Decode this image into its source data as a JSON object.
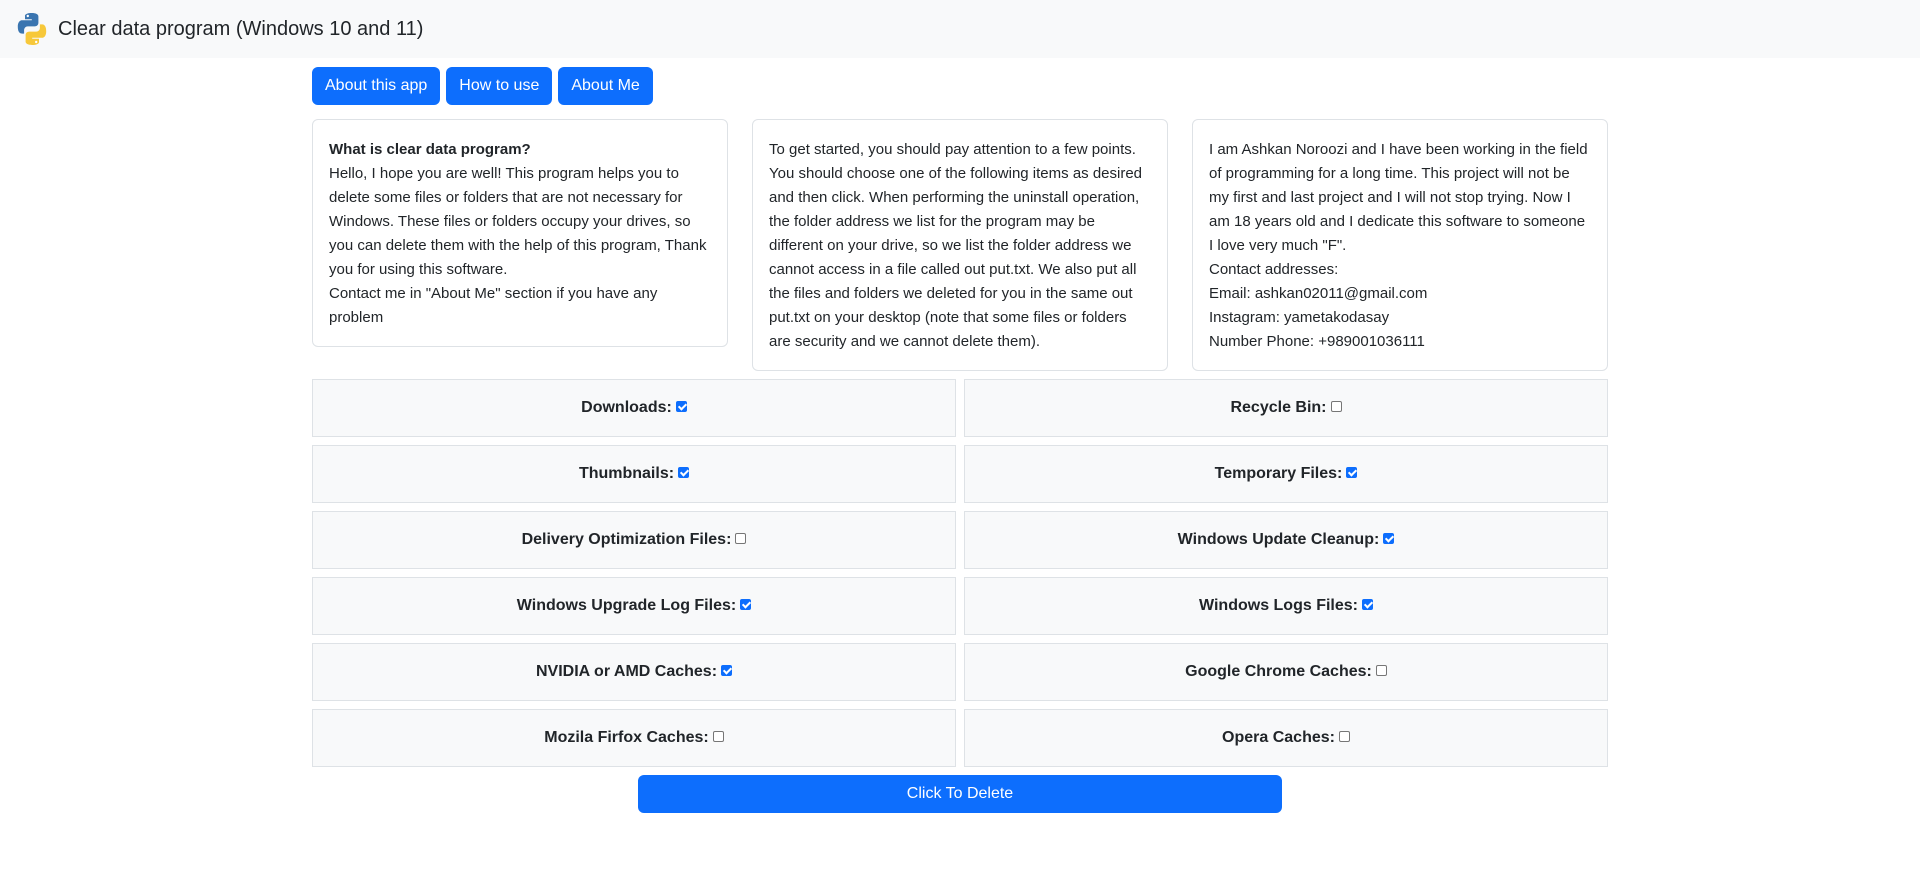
{
  "app": {
    "title": "Clear data program (Windows 10 and 11)"
  },
  "tabs": [
    {
      "label": "About this app"
    },
    {
      "label": "How to use"
    },
    {
      "label": "About Me"
    }
  ],
  "cards": {
    "about_app": {
      "heading": "What is clear data program?",
      "lines": [
        "Hello, I hope you are well! This program helps you to delete some files or folders that are not necessary for Windows. These files or folders occupy your drives, so you can delete them with the help of this program, Thank you for using this software.",
        "Contact me in \"About Me\" section if you have any problem"
      ]
    },
    "how_to_use": {
      "text": "To get started, you should pay attention to a few points. You should choose one of the following items as desired and then click. When performing the uninstall operation, the folder address we list for the program may be different on your drive, so we list the folder address we cannot access in a file called out put.txt. We also put all the files and folders we deleted for you in the same out put.txt on your desktop (note that some files or folders are security and we cannot delete them)."
    },
    "about_me": {
      "lines": [
        "I am Ashkan Noroozi and I have been working in the field of programming for a long time. This project will not be my first and last project and I will not stop trying. Now I am 18 years old and I dedicate this software to someone I love very much \"F\".",
        "Contact addresses:",
        "Email: ashkan02011@gmail.com",
        "Instagram: yametakodasay",
        "Number Phone: +989001036111"
      ]
    }
  },
  "options": [
    {
      "label": "Downloads:",
      "checked": true
    },
    {
      "label": "Recycle Bin:",
      "checked": false
    },
    {
      "label": "Thumbnails:",
      "checked": true
    },
    {
      "label": "Temporary Files:",
      "checked": true
    },
    {
      "label": "Delivery Optimization Files:",
      "checked": false
    },
    {
      "label": "Windows Update Cleanup:",
      "checked": true
    },
    {
      "label": "Windows Upgrade Log Files:",
      "checked": true
    },
    {
      "label": "Windows Logs Files:",
      "checked": true
    },
    {
      "label": "NVIDIA or AMD Caches:",
      "checked": true
    },
    {
      "label": "Google Chrome Caches:",
      "checked": false
    },
    {
      "label": "Mozila Firfox Caches:",
      "checked": false
    },
    {
      "label": "Opera Caches:",
      "checked": false
    }
  ],
  "delete_button": {
    "label": "Click To Delete"
  },
  "colors": {
    "primary": "#0d6efd",
    "navbar": "#f8f9fa",
    "option_bg": "#f8f9fa",
    "border": "#dee2e6"
  },
  "icons": {
    "logo": "python-logo-icon"
  }
}
